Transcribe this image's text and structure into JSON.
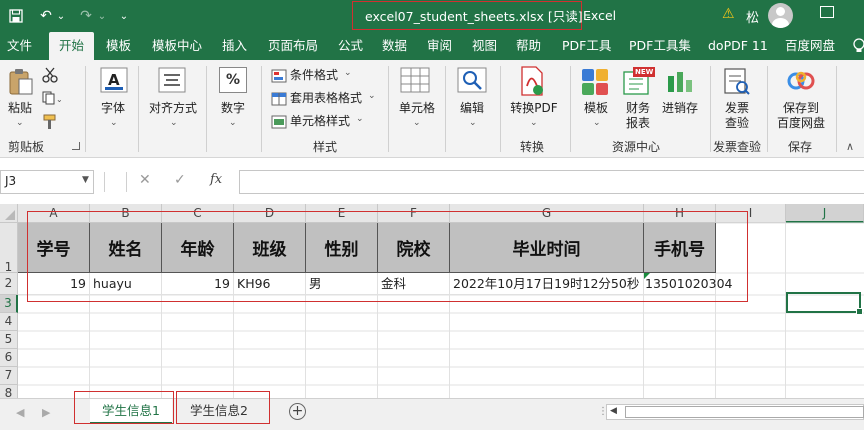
{
  "titlebar": {
    "file_name": "excel07_student_sheets.xlsx  [只读]  -",
    "app_name": "Excel",
    "user_name": "松",
    "icons": {
      "undo": "↶",
      "undo_dropdown": "⌄",
      "redo": "↷",
      "redo_dropdown": "⌄",
      "customize": "⌄",
      "warning": "⚠"
    }
  },
  "tabs": [
    "文件",
    "开始",
    "模板",
    "模板中心",
    "插入",
    "页面布局",
    "公式",
    "数据",
    "审阅",
    "视图",
    "帮助",
    "PDF工具",
    "PDF工具集",
    "doPDF 11",
    "百度网盘"
  ],
  "active_tab": "开始",
  "ribbon": {
    "paste": "粘贴",
    "clipboard_group": "剪贴板",
    "font": "字体",
    "align": "对齐方式",
    "number": "数字",
    "pct_symbol": "%",
    "cond_format": "条件格式",
    "table_format": "套用表格格式",
    "cell_style": "单元格样式",
    "styles_group": "样式",
    "cells": "单元格",
    "edit": "编辑",
    "to_pdf": "转换PDF",
    "convert_group": "转换",
    "template": "模板",
    "finance1": "财务",
    "finance2": "报表",
    "invoicing": "进销存",
    "new_badge": "NEW",
    "resource_group": "资源中心",
    "invoice_check1": "发票",
    "invoice_check2": "查验",
    "invoice_group": "发票查验",
    "save_baidu1": "保存到",
    "save_baidu2": "百度网盘",
    "save_group": "保存"
  },
  "formula_bar": {
    "name_box": "J3",
    "cancel": "✕",
    "enter": "✓",
    "fx": "fx",
    "value": ""
  },
  "columns": [
    "A",
    "B",
    "C",
    "D",
    "E",
    "F",
    "G",
    "H",
    "I",
    "J"
  ],
  "rows": [
    "1",
    "2",
    "3",
    "4",
    "5",
    "6",
    "7",
    "8"
  ],
  "header_row": [
    "学号",
    "姓名",
    "年龄",
    "班级",
    "性别",
    "院校",
    "毕业时间",
    "手机号"
  ],
  "data_row": [
    "19",
    "huayu",
    "19",
    "KH96",
    "男",
    "金科",
    "2022年10月17日19时12分50秒",
    "13501020304"
  ],
  "sheets": [
    "学生信息1",
    "学生信息2"
  ],
  "active_sheet": "学生信息1",
  "colors": {
    "excel_green": "#217346",
    "header_fill": "#c0c0c0",
    "annotation_red": "#d03030"
  }
}
